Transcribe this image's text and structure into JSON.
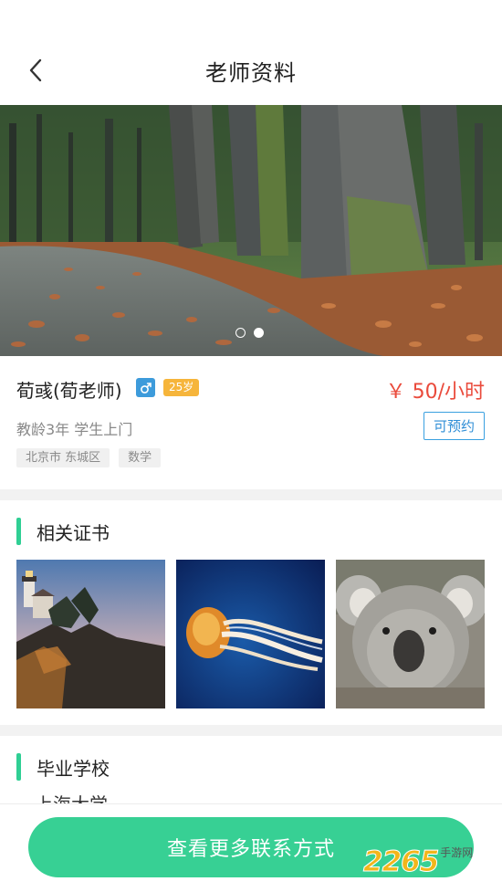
{
  "header": {
    "title": "老师资料",
    "back_icon": "chevron-left-icon"
  },
  "banner": {
    "image": "forest-path-autumn-leaves",
    "slide_count": 2,
    "active_index": 1
  },
  "teacher": {
    "name": "荀彧(荀老师)",
    "gender_icon": "male-icon",
    "age": "25岁",
    "price": "￥ 50/小时",
    "experience": "教龄3年  学生上门",
    "availability": "可预约",
    "tags": [
      "北京市 东城区",
      "数学"
    ]
  },
  "certificates": {
    "title": "相关证书",
    "images": [
      "lighthouse-photo",
      "jellyfish-photo",
      "koala-photo"
    ]
  },
  "school": {
    "title": "毕业学校",
    "value": "上海大学"
  },
  "cta": {
    "label": "查看更多联系方式"
  },
  "watermark": {
    "number": "2265",
    "text": "手游网"
  },
  "colors": {
    "accent": "#37d094",
    "price": "#ea4b3c",
    "book": "#2f8ed6",
    "age_badge": "#f6b53b",
    "gender_badge": "#3d9bdb"
  }
}
